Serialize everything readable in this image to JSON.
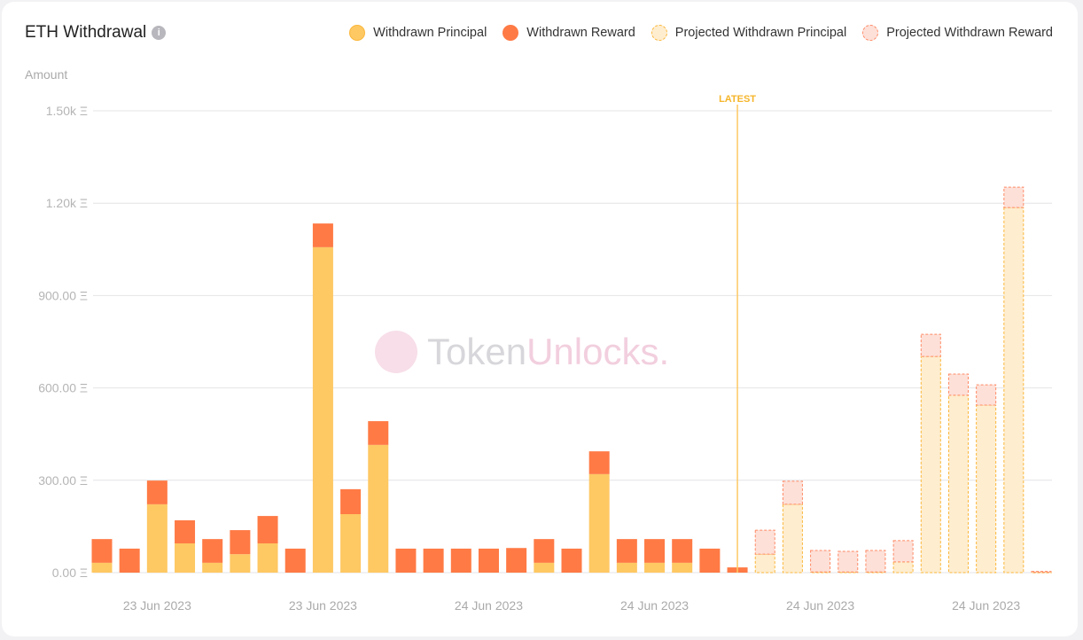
{
  "title": "ETH Withdrawal",
  "info_icon": "info-icon",
  "legend": [
    {
      "label": "Withdrawn Principal",
      "color": "#fec863",
      "style": "solid"
    },
    {
      "label": "Withdrawn Reward",
      "color": "#ff7a45",
      "style": "solid"
    },
    {
      "label": "Projected Withdrawn Principal",
      "color": "#feedcf",
      "style": "dashed"
    },
    {
      "label": "Projected Withdrawn Reward",
      "color": "#fde0d8",
      "style": "dashed"
    }
  ],
  "watermark": "TokenUnlocks.",
  "chart_data": {
    "type": "bar",
    "stacked": true,
    "ylabel": "Amount",
    "ylim": [
      0,
      1500
    ],
    "yticks": [
      {
        "value": 0,
        "label": "0.00 Ξ"
      },
      {
        "value": 300,
        "label": "300.00 Ξ"
      },
      {
        "value": 600,
        "label": "600.00 Ξ"
      },
      {
        "value": 900,
        "label": "900.00 Ξ"
      },
      {
        "value": 1200,
        "label": "1.20k Ξ"
      },
      {
        "value": 1500,
        "label": "1.50k Ξ"
      }
    ],
    "grid": true,
    "xtick_labels": [
      {
        "index": 2,
        "label": "23 Jun 2023"
      },
      {
        "index": 8,
        "label": "23 Jun 2023"
      },
      {
        "index": 14,
        "label": "24 Jun 2023"
      },
      {
        "index": 20,
        "label": "24 Jun 2023"
      },
      {
        "index": 26,
        "label": "24 Jun 2023"
      },
      {
        "index": 32,
        "label": "24 Jun 2023"
      }
    ],
    "latest_marker": {
      "label": "LATEST",
      "after_index": 23
    },
    "series": [
      {
        "name": "Withdrawn Principal",
        "values": [
          32,
          0,
          222,
          95,
          32,
          60,
          95,
          0,
          1057,
          190,
          415,
          0,
          0,
          0,
          0,
          0,
          32,
          0,
          320,
          32,
          32,
          32,
          0,
          0,
          null,
          null,
          null,
          null,
          null,
          null,
          null,
          null,
          null,
          null,
          null
        ]
      },
      {
        "name": "Withdrawn Reward",
        "values": [
          77,
          78,
          77,
          75,
          77,
          78,
          89,
          78,
          77,
          81,
          77,
          78,
          78,
          78,
          78,
          80,
          77,
          78,
          74,
          77,
          77,
          77,
          78,
          17,
          null,
          null,
          null,
          null,
          null,
          null,
          null,
          null,
          null,
          null,
          null
        ]
      },
      {
        "name": "Projected Withdrawn Principal",
        "values": [
          null,
          null,
          null,
          null,
          null,
          null,
          null,
          null,
          null,
          null,
          null,
          null,
          null,
          null,
          null,
          null,
          null,
          null,
          null,
          null,
          null,
          null,
          null,
          null,
          60,
          222,
          2,
          2,
          2,
          35,
          702,
          576,
          544,
          1186,
          1
        ]
      },
      {
        "name": "Projected Withdrawn Reward",
        "values": [
          null,
          null,
          null,
          null,
          null,
          null,
          null,
          null,
          null,
          null,
          null,
          null,
          null,
          null,
          null,
          null,
          null,
          null,
          null,
          null,
          null,
          null,
          null,
          null,
          78,
          75,
          70,
          67,
          70,
          69,
          72,
          69,
          66,
          66,
          3
        ]
      }
    ]
  }
}
